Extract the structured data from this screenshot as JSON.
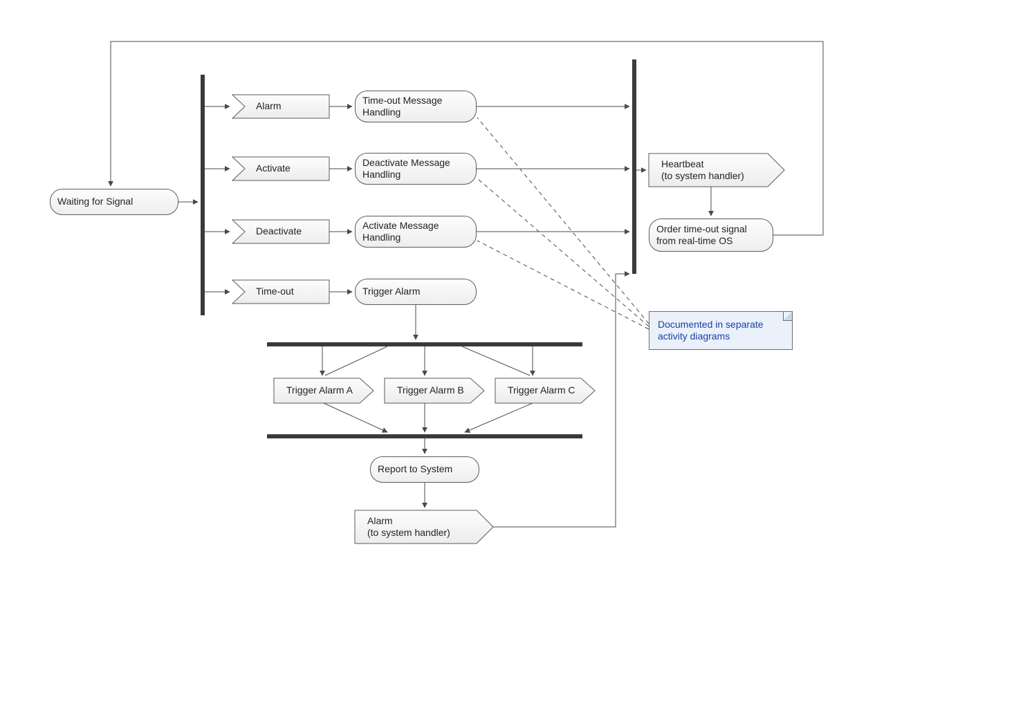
{
  "nodes": {
    "waiting": "Waiting for Signal",
    "sig_alarm": "Alarm",
    "sig_activate": "Activate",
    "sig_deactivate": "Deactivate",
    "sig_timeout": "Time-out",
    "act_timeout_handling": "Time-out Message Handling",
    "act_deactivate_handling": "Deactivate Message Handling",
    "act_activate_handling": "Activate Message Handling",
    "act_trigger_alarm": "Trigger Alarm",
    "send_trigger_a": "Trigger Alarm A",
    "send_trigger_b": "Trigger Alarm B",
    "send_trigger_c": "Trigger Alarm C",
    "act_report": "Report to System",
    "send_alarm": "Alarm\n(to system handler)",
    "send_heartbeat": "Heartbeat\n(to system handler)",
    "act_order_timeout": "Order time-out signal from real-time OS"
  },
  "note": "Documented in separate activity diagrams"
}
